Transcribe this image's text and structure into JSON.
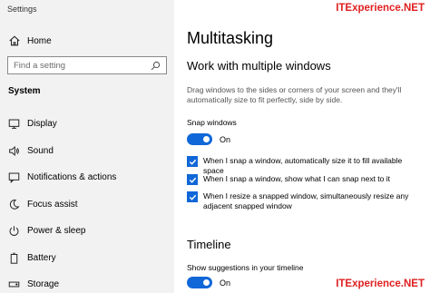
{
  "window": {
    "title": "Settings"
  },
  "sidebar": {
    "home_label": "Home",
    "search_placeholder": "Find a setting",
    "section_label": "System",
    "items": [
      {
        "label": "Display",
        "icon": "display-icon"
      },
      {
        "label": "Sound",
        "icon": "speaker-icon"
      },
      {
        "label": "Notifications & actions",
        "icon": "notifications-icon"
      },
      {
        "label": "Focus assist",
        "icon": "moon-icon"
      },
      {
        "label": "Power & sleep",
        "icon": "power-icon"
      },
      {
        "label": "Battery",
        "icon": "battery-icon"
      },
      {
        "label": "Storage",
        "icon": "storage-icon"
      }
    ]
  },
  "main": {
    "title": "Multitasking",
    "section_title": "Work with multiple windows",
    "description": "Drag windows to the sides or corners of your screen and they'll automatically size to fit perfectly, side by side.",
    "snap_windows_label": "Snap windows",
    "snap_windows_state": "On",
    "checkboxes": [
      {
        "label": "When I snap a window, automatically size it to fill available space",
        "checked": true
      },
      {
        "label": "When I snap a window, show what I can snap next to it",
        "checked": true
      },
      {
        "label": "When I resize a snapped window, simultaneously resize any adjacent snapped window",
        "checked": true
      }
    ],
    "timeline_title": "Timeline",
    "suggestions_label": "Show suggestions in your timeline",
    "suggestions_state": "On"
  },
  "watermark": {
    "text": "ITExperience.NET"
  },
  "colors": {
    "accent": "#1067d8",
    "sidebar_bg": "#f2f2f2",
    "watermark": "#e02020"
  }
}
